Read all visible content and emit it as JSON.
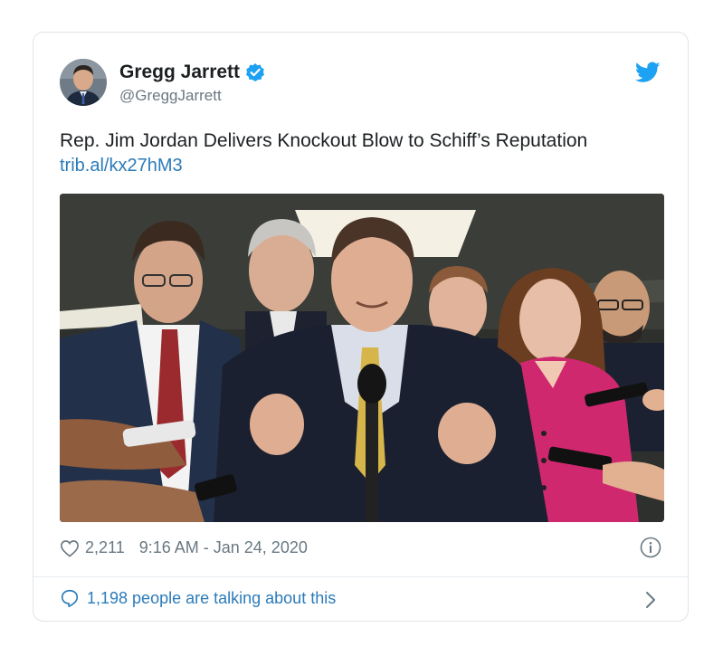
{
  "author": {
    "display_name": "Gregg Jarrett",
    "handle": "@GreggJarrett",
    "verified": true,
    "avatar_icon": "profile-photo"
  },
  "tweet": {
    "text": "Rep. Jim Jordan Delivers Knockout Blow to Schiff’s Reputation",
    "link": "trib.al/kx27hM3"
  },
  "media": {
    "description_icon": "press-conference-photo"
  },
  "meta": {
    "likes": "2,211",
    "timestamp": "9:16 AM - Jan 24, 2020"
  },
  "footer": {
    "conversation_text": "1,198 people are talking about this"
  },
  "colors": {
    "twitter_blue": "#1da1f2",
    "link_blue": "#2b7bb9",
    "secondary_gray": "#697882"
  },
  "icons": [
    "verified-badge-icon",
    "twitter-bird-icon",
    "heart-icon",
    "info-icon",
    "speech-bubble-icon",
    "chevron-right-icon"
  ]
}
